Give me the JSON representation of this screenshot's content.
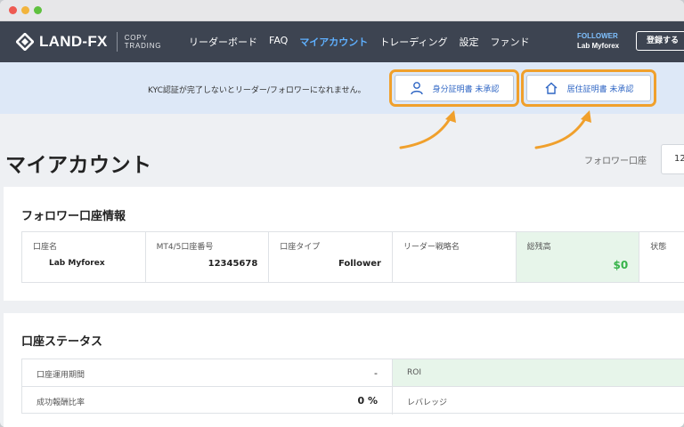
{
  "navbar": {
    "brand": "LAND-FX",
    "brand_sub_line1": "COPY",
    "brand_sub_line2": "TRADING",
    "menu": [
      "リーダーボード",
      "FAQ",
      "マイアカウント",
      "トレーディング",
      "設定",
      "ファンド"
    ],
    "active_menu": "マイアカウント",
    "role": "FOLLOWER",
    "user_name": "Lab Myforex",
    "register_label": "登録する"
  },
  "kyc": {
    "message": "KYC認証が完了しないとリーダー/フォロワーになれません。",
    "identity_button": "身分証明書 未承認",
    "residence_button": "居住証明書 未承認",
    "highlight_color": "#f0a02c"
  },
  "page": {
    "title": "マイアカウント",
    "account_label": "フォロワー口座",
    "account_select_value": "12"
  },
  "follower_info": {
    "title": "フォロワー口座情報",
    "columns": [
      {
        "label": "口座名",
        "value": "Lab Myforex"
      },
      {
        "label": "MT4/5口座番号",
        "value": "12345678"
      },
      {
        "label": "口座タイプ",
        "value": "Follower"
      },
      {
        "label": "リーダー戦略名",
        "value": ""
      },
      {
        "label": "総残高",
        "value": "$0"
      },
      {
        "label": "状態",
        "value": ""
      }
    ]
  },
  "account_status": {
    "title": "口座ステータス",
    "rows": [
      {
        "label": "口座運用期間",
        "value": "-",
        "right_label": "ROI"
      },
      {
        "label": "成功報酬比率",
        "value": "0 %",
        "right_label": "レバレッジ"
      }
    ]
  },
  "colors": {
    "navbar_bg": "#3d4451",
    "active_link": "#5fb0ff",
    "kyc_bg": "#dde8f7",
    "positive": "#37b34a"
  }
}
